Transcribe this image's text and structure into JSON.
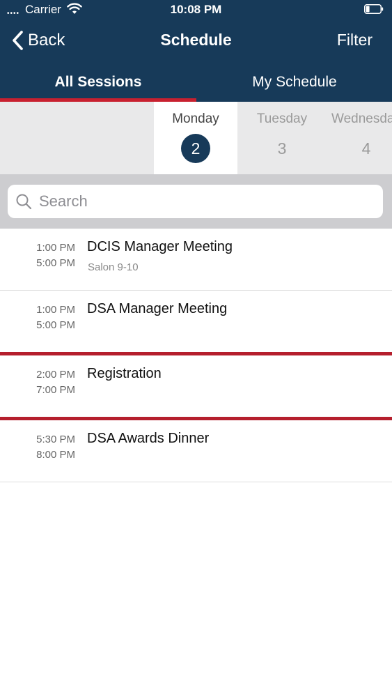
{
  "status_bar": {
    "signal": "••••",
    "carrier": "Carrier",
    "time": "10:08 PM"
  },
  "nav": {
    "back_label": "Back",
    "title": "Schedule",
    "filter_label": "Filter"
  },
  "tabs": [
    {
      "label": "All Sessions",
      "active": true
    },
    {
      "label": "My Schedule",
      "active": false
    }
  ],
  "days": [
    {
      "name": "Monday",
      "number": "2",
      "selected": true
    },
    {
      "name": "Tuesday",
      "number": "3",
      "selected": false
    },
    {
      "name": "Wednesday",
      "number": "4",
      "selected": false
    }
  ],
  "search": {
    "placeholder": "Search",
    "value": ""
  },
  "sessions": [
    {
      "start": "1:00 PM",
      "end": "5:00 PM",
      "title": "DCIS Manager Meeting",
      "location": "Salon 9-10"
    },
    {
      "start": "1:00 PM",
      "end": "5:00 PM",
      "title": "DSA Manager Meeting",
      "location": ""
    },
    {
      "start": "2:00 PM",
      "end": "7:00 PM",
      "title": "Registration",
      "location": ""
    },
    {
      "start": "5:30 PM",
      "end": "8:00 PM",
      "title": "DSA Awards Dinner",
      "location": ""
    }
  ],
  "colors": {
    "navy": "#173a59",
    "accent_red": "#c8202f",
    "day_strip_bg": "#e9e9ea",
    "search_bg": "#cdcdd0"
  }
}
